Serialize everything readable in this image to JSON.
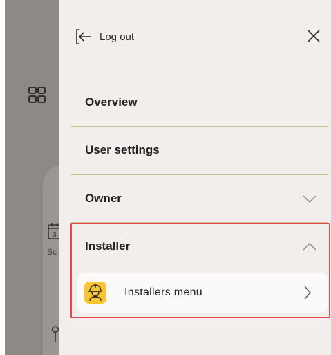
{
  "background_app": {
    "schedule_label_fragment": "Sc",
    "calendar_day": "3"
  },
  "drawer": {
    "logout_label": "Log out",
    "items": [
      {
        "label": "Overview"
      },
      {
        "label": "User settings"
      },
      {
        "label": "Owner",
        "chevron": "chevron-down-icon"
      },
      {
        "label": "Installer",
        "chevron": "chevron-up-icon"
      }
    ],
    "installer_submenu": {
      "label": "Installers menu",
      "icon": "worker-helmet-icon",
      "icon_bg": "#f7c632"
    }
  },
  "colors": {
    "drawer_bg": "#f1eeeb",
    "divider": "#cdbf94",
    "highlight": "#e5464f",
    "backdrop": "#8d8a86"
  }
}
